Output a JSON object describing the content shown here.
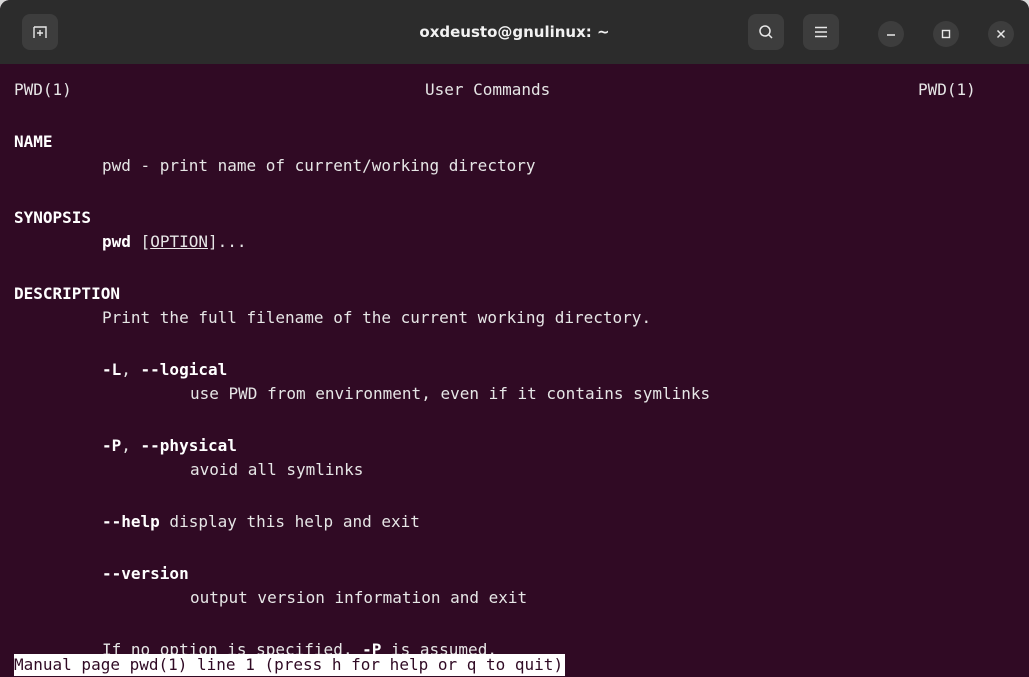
{
  "window": {
    "title": "oxdeusto@gnulinux: ~"
  },
  "icons": {
    "new_tab": "new-tab-icon",
    "search": "search-icon",
    "menu": "hamburger-menu-icon",
    "minimize": "minimize-icon",
    "maximize": "maximize-icon",
    "close": "close-icon"
  },
  "man": {
    "header_left": "PWD(1)",
    "header_center": "User Commands",
    "header_right": "PWD(1)",
    "name_heading": "NAME",
    "name_text": "pwd - print name of current/working directory",
    "synopsis_heading": "SYNOPSIS",
    "synopsis_cmd": "pwd",
    "synopsis_open": "[",
    "synopsis_option": "OPTION",
    "synopsis_close": "]...",
    "description_heading": "DESCRIPTION",
    "description_text": "Print the full filename of the current working directory.",
    "opt_L_short": "-L",
    "opt_L_sep": ", ",
    "opt_L_long": "--logical",
    "opt_L_desc": "use PWD from environment, even if it contains symlinks",
    "opt_P_short": "-P",
    "opt_P_sep": ", ",
    "opt_P_long": "--physical",
    "opt_P_desc": "avoid all symlinks",
    "opt_help": "--help",
    "opt_help_desc": " display this help and exit",
    "opt_version": "--version",
    "opt_version_desc": "output version information and exit",
    "default_pre": "If no option is specified, ",
    "default_opt": "-P",
    "default_post": " is assumed."
  },
  "status_line": "Manual page pwd(1) line 1 (press h for help or q to quit)",
  "colors": {
    "terminal_bg": "#300a24",
    "titlebar_bg": "#2c2c2c",
    "text": "#e6e6e6"
  }
}
